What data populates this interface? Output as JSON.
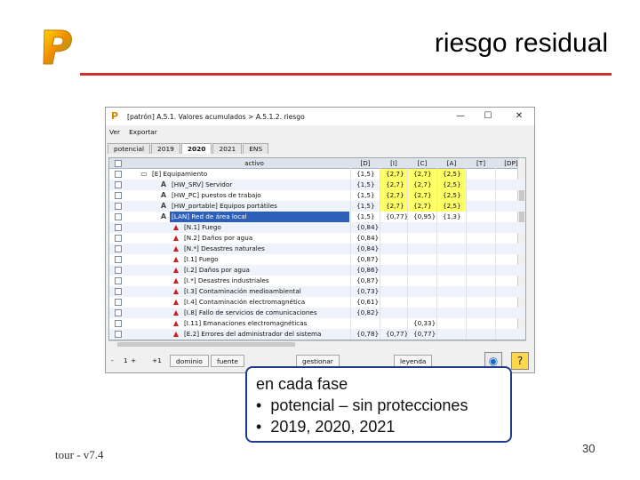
{
  "slide": {
    "title": "riesgo residual",
    "footer": "tour - v7.4",
    "page_number": "30",
    "accent_color": "#d0302a",
    "logo_icon": "pilar-logo-icon"
  },
  "window": {
    "title": "[patrón] A.5.1. Valores acumulados > A.5.1.2. riesgo",
    "minimize": "—",
    "maximize": "☐",
    "close": "✕",
    "menu": [
      "Ver",
      "Exportar"
    ],
    "tabs": [
      "potencial",
      "2019",
      "2020",
      "2021",
      "ENS"
    ],
    "selected_tab": "2020",
    "columns": {
      "activo": "activo",
      "D": "[D]",
      "I": "[I]",
      "C": "[C]",
      "A": "[A]",
      "T": "[T]",
      "DP": "[DP]"
    },
    "rows": [
      {
        "icon": "folder-icon",
        "label": "[E] Equipamiento",
        "D": "{1,5}",
        "I": "{2,7}",
        "C": "{2,7}",
        "A": "{2,5}"
      },
      {
        "icon": "asset-icon",
        "label": "[HW_SRV] Servidor",
        "D": "{1,5}",
        "I": "{2,7}",
        "C": "{2,7}",
        "A": "{2,5}"
      },
      {
        "icon": "asset-icon",
        "label": "[HW_PC] puestos de trabajo",
        "D": "{1,5}",
        "I": "{2,7}",
        "C": "{2,7}",
        "A": "{2,5}"
      },
      {
        "icon": "asset-icon",
        "label": "[HW_portable] Equipos portátiles",
        "D": "{1,5}",
        "I": "{2,7}",
        "C": "{2,7}",
        "A": "{2,5}"
      },
      {
        "icon": "asset-icon",
        "label": "[LAN] Red de área local",
        "D": "{1,5}",
        "I": "{0,77}",
        "C": "{0,95}",
        "A": "{1,3}"
      },
      {
        "icon": "warning-icon",
        "label": "[N.1] Fuego",
        "D": "{0,84}"
      },
      {
        "icon": "warning-icon",
        "label": "[N.2] Daños por agua",
        "D": "{0,84}"
      },
      {
        "icon": "warning-icon",
        "label": "[N.*] Desastres naturales",
        "D": "{0,84}"
      },
      {
        "icon": "warning-icon",
        "label": "[I.1] Fuego",
        "D": "{0,87}"
      },
      {
        "icon": "warning-icon",
        "label": "[I.2] Daños por agua",
        "D": "{0,86}"
      },
      {
        "icon": "warning-icon",
        "label": "[I.*] Desastres industriales",
        "D": "{0,87}"
      },
      {
        "icon": "warning-icon",
        "label": "[I.3] Contaminación medioambiental",
        "D": "{0,73}"
      },
      {
        "icon": "warning-icon",
        "label": "[I.4] Contaminación electromagnética",
        "D": "{0,61}"
      },
      {
        "icon": "warning-icon",
        "label": "[I.8] Fallo de servicios de comunicaciones",
        "D": "{0,82}"
      },
      {
        "icon": "warning-icon",
        "label": "[I.11] Emanaciones electromagnéticas",
        "C": "{0,33}"
      },
      {
        "icon": "warning-icon",
        "label": "[E.2] Errores del administrador del sistema",
        "D": "{0,78}",
        "I": "{0,77}",
        "C": "{0,77}"
      }
    ],
    "highlight_color": "#ffff66",
    "bottom": {
      "minus": "-",
      "level_value": "1",
      "plus": "+",
      "plus_one": "+1",
      "dominio": "dominio",
      "fuente": "fuente",
      "gestionar": "gestionar",
      "leyenda": "leyenda"
    }
  },
  "callout": {
    "heading": "en cada fase",
    "bullets": [
      "potencial – sin protecciones",
      "2019, 2020, 2021"
    ],
    "border_color": "#1f3c8a"
  }
}
